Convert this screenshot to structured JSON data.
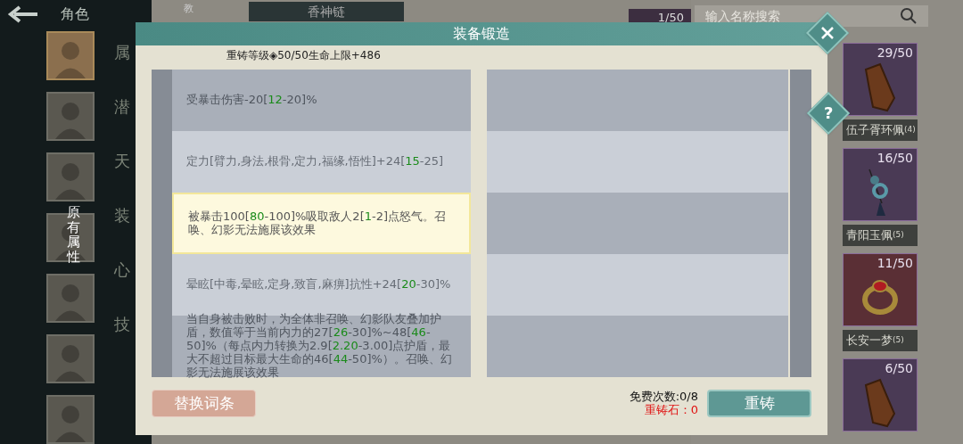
{
  "header": {
    "back_label": "角色",
    "tab_label": "香神链",
    "hint_char": "教",
    "slot_count": "1/50"
  },
  "avatars": [
    {
      "selected": true
    },
    {
      "selected": false
    },
    {
      "selected": false
    },
    {
      "selected": false
    },
    {
      "selected": false
    },
    {
      "selected": false
    },
    {
      "selected": false
    }
  ],
  "menu": [
    "属",
    "潜",
    "天",
    "装",
    "心",
    "技"
  ],
  "side_label": "原有属性",
  "search": {
    "placeholder": "输入名称搜索"
  },
  "items": [
    {
      "kind": "tablet",
      "color": "#4a3a55",
      "count": "29/50",
      "name": "伍子胥环佩",
      "grade": "(4)"
    },
    {
      "kind": "pendant",
      "color": "#4a3a55",
      "count": "16/50",
      "name": "青阳玉佩",
      "grade": "(5)"
    },
    {
      "kind": "ring",
      "color": "#5a2f35",
      "count": "11/50",
      "name": "长安一梦",
      "grade": "(5)"
    },
    {
      "kind": "tablet",
      "color": "#4a3a55",
      "count": "6/50"
    }
  ],
  "dialog": {
    "title": "装备锻造",
    "subtitle": "重铸等级◈50/50生命上限+486",
    "attributes": [
      {
        "text": "受暴击伤害-20[**12**-20]%",
        "selected": false
      },
      {
        "text": "定力[臂力,身法,根骨,定力,福缘,悟性]+24[**15**-25]",
        "selected": false
      },
      {
        "text": "被暴击100[**80**-100]%吸取敌人2[**1**-2]点怒气。召唤、幻影无法施展该效果",
        "selected": true
      },
      {
        "text": "晕眩[中毒,晕眩,定身,致盲,麻痹]抗性+24[**20**-30]%",
        "selected": false
      },
      {
        "text": "当自身被击败时，为全体非召唤、幻影队友叠加护盾，数值等于当前内力的27[**26**-30]%~48[**46**-50]%（每点内力转换为2.9[**2.20**-3.00]点护盾，最大不超过目标最大生命的46[**44**-50]%）。召唤、幻影无法施展该效果",
        "selected": false
      }
    ],
    "help_label": "?",
    "replace_button": "替换词条",
    "free_times": "免费次数:0/8",
    "stone": "重铸石：0",
    "reforge_button": "重铸"
  }
}
